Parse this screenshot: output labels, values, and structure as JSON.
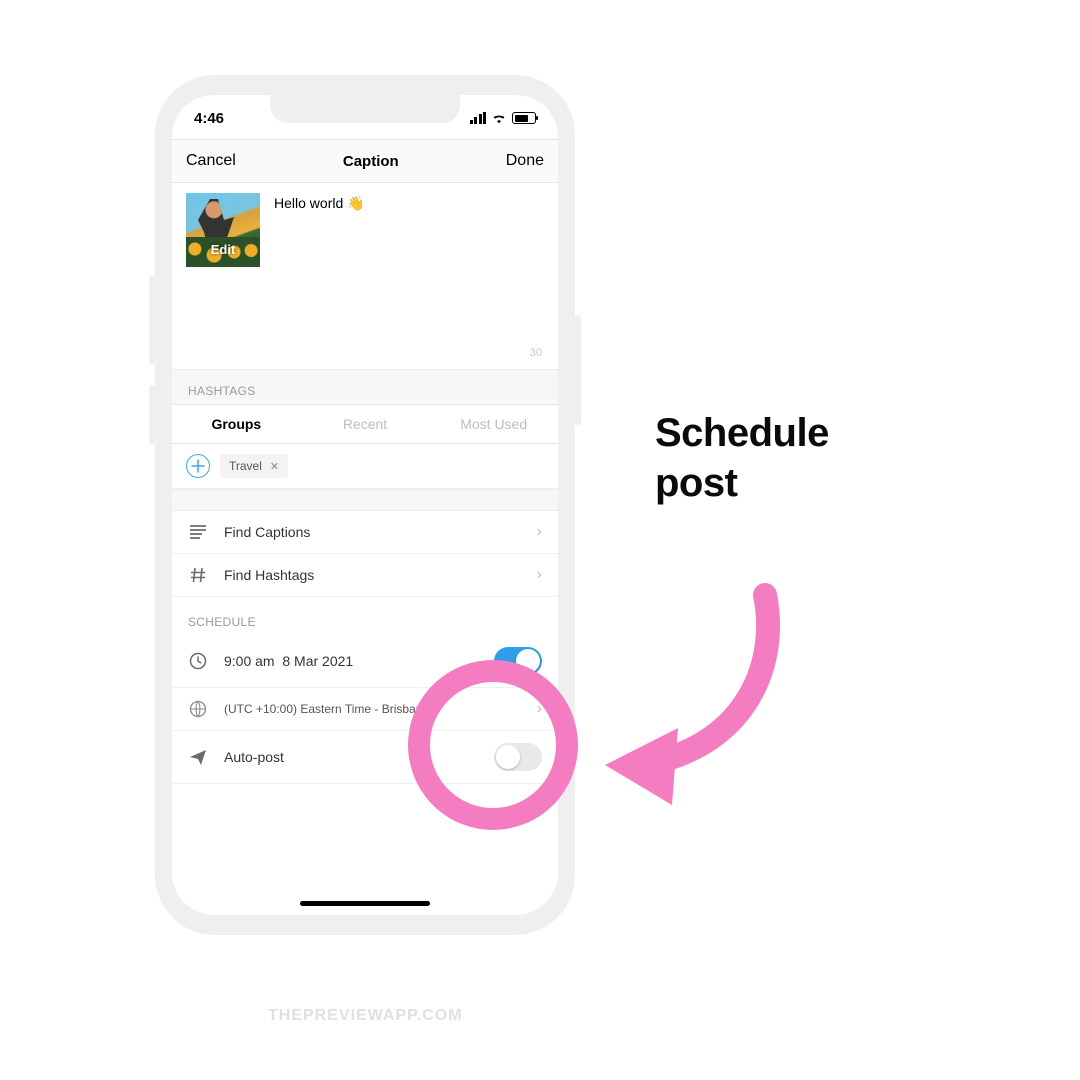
{
  "statusbar": {
    "time": "4:46"
  },
  "navbar": {
    "cancel": "Cancel",
    "title": "Caption",
    "done": "Done"
  },
  "caption": {
    "text": "Hello world 👋",
    "edit_label": "Edit",
    "char_limit": "30"
  },
  "hashtags": {
    "section_label": "HASHTAGS",
    "tabs": {
      "groups": "Groups",
      "recent": "Recent",
      "most_used": "Most Used"
    },
    "chip": {
      "label": "Travel"
    }
  },
  "find": {
    "captions": "Find Captions",
    "hashtags": "Find Hashtags"
  },
  "schedule": {
    "section_label": "SCHEDULE",
    "time": "9:00 am",
    "date": "8 Mar 2021",
    "timezone": "(UTC +10:00) Eastern Time - Brisbane",
    "autopost": "Auto-post"
  },
  "annotation": {
    "line1": "Schedule",
    "line2": "post"
  },
  "watermark": "THEPREVIEWAPP.COM",
  "colors": {
    "accent_pink": "#f37dc0",
    "toggle_blue": "#2e9fe6"
  }
}
